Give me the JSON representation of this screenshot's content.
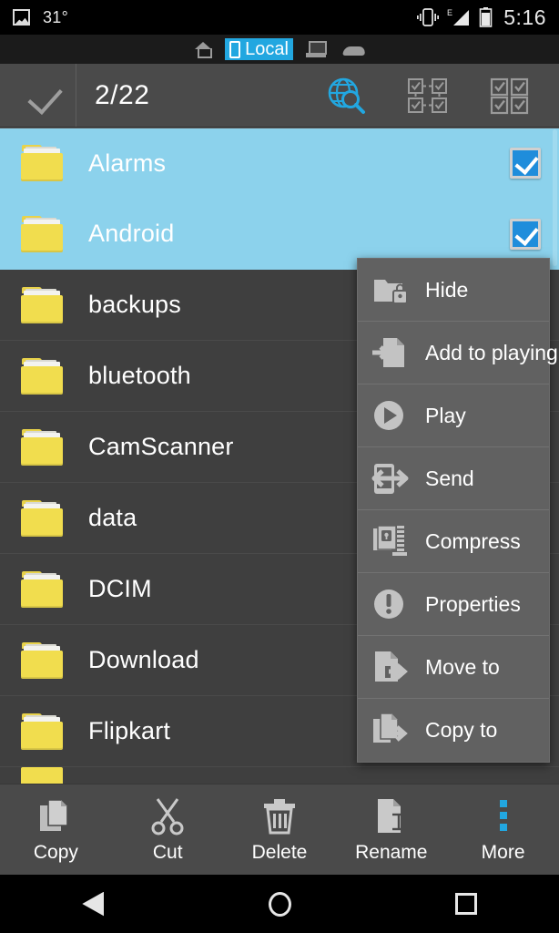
{
  "statusbar": {
    "photo_icon": "photo-icon",
    "temperature": "31°",
    "vibrate_icon": "vibrate-icon",
    "network_type": "E",
    "signal_icon": "signal-icon",
    "battery_icon": "battery-icon",
    "time": "5:16"
  },
  "tabs": [
    {
      "name": "home",
      "label": "",
      "icon": "home-icon",
      "active": false
    },
    {
      "name": "local",
      "label": "Local",
      "icon": "phone-icon",
      "active": true
    },
    {
      "name": "network",
      "label": "",
      "icon": "computer-icon",
      "active": false
    },
    {
      "name": "cloud",
      "label": "",
      "icon": "cloud-icon",
      "active": false
    }
  ],
  "actionbar": {
    "confirm_icon": "checkmark-icon",
    "selection_count": "2/22",
    "search_icon": "globe-search-icon",
    "invert_selection_icon": "invert-selection-icon",
    "select_all_icon": "select-all-icon"
  },
  "files": [
    {
      "name": "Alarms",
      "type": "folder",
      "selected": true
    },
    {
      "name": "Android",
      "type": "folder",
      "selected": true
    },
    {
      "name": "backups",
      "type": "folder",
      "selected": false
    },
    {
      "name": "bluetooth",
      "type": "folder",
      "selected": false
    },
    {
      "name": "CamScanner",
      "type": "folder",
      "selected": false
    },
    {
      "name": "data",
      "type": "folder",
      "selected": false
    },
    {
      "name": "DCIM",
      "type": "folder",
      "selected": false
    },
    {
      "name": "Download",
      "type": "folder",
      "selected": false
    },
    {
      "name": "Flipkart",
      "type": "folder",
      "selected": false
    }
  ],
  "context_menu": [
    {
      "label": "Hide",
      "icon": "folder-lock-icon"
    },
    {
      "label": "Add to playing",
      "icon": "add-to-playlist-icon"
    },
    {
      "label": "Play",
      "icon": "play-icon"
    },
    {
      "label": "Send",
      "icon": "send-icon"
    },
    {
      "label": "Compress",
      "icon": "compress-icon"
    },
    {
      "label": "Properties",
      "icon": "properties-icon"
    },
    {
      "label": "Move to",
      "icon": "move-to-icon"
    },
    {
      "label": "Copy to",
      "icon": "copy-to-icon"
    }
  ],
  "bottombar": [
    {
      "label": "Copy",
      "icon": "copy-icon",
      "active": false
    },
    {
      "label": "Cut",
      "icon": "scissors-icon",
      "active": false
    },
    {
      "label": "Delete",
      "icon": "trash-icon",
      "active": false
    },
    {
      "label": "Rename",
      "icon": "rename-icon",
      "active": false
    },
    {
      "label": "More",
      "icon": "more-vertical-icon",
      "active": true
    }
  ],
  "navbar": [
    {
      "name": "back",
      "icon": "triangle-back-icon"
    },
    {
      "name": "home",
      "icon": "circle-home-icon"
    },
    {
      "name": "recent",
      "icon": "square-recent-icon"
    }
  ],
  "colors": {
    "accent": "#22a7e0",
    "selection_bg": "#8cd2ec",
    "checkbox_blue": "#1f8ddb",
    "folder_yellow": "#f1dd4e",
    "bar_bg": "#4a4a4a",
    "list_bg": "#3f3f3f",
    "menu_bg": "#616161"
  }
}
